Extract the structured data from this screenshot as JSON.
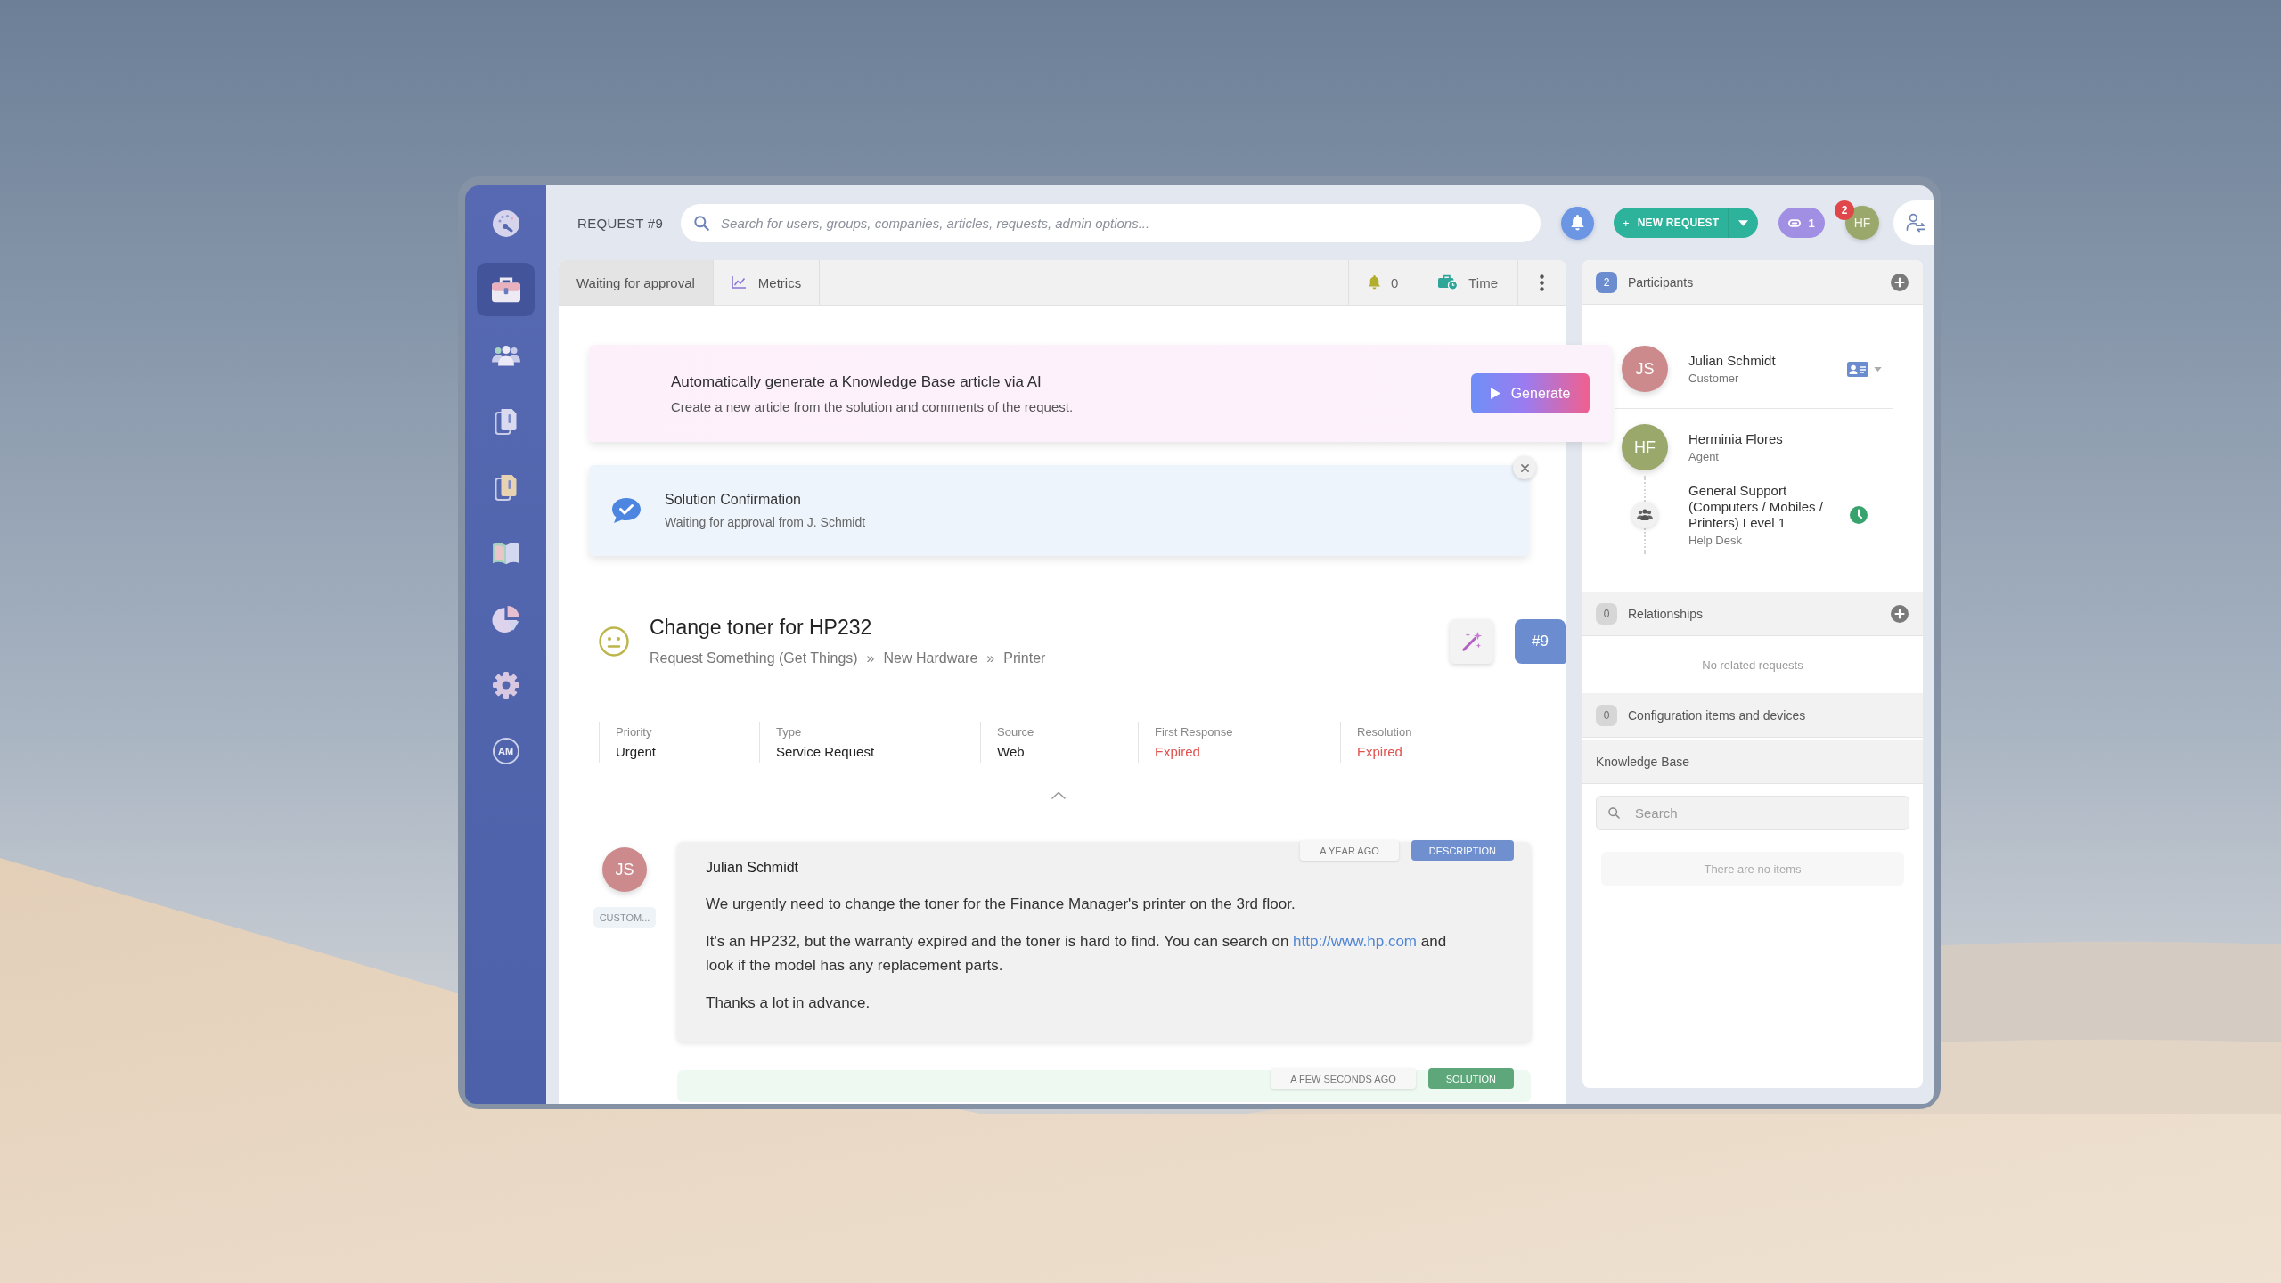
{
  "sidebar": {
    "items": [
      {
        "kind": "gauge",
        "selected": false
      },
      {
        "kind": "briefcase",
        "selected": true
      },
      {
        "kind": "people",
        "selected": false
      },
      {
        "kind": "documents",
        "selected": false
      },
      {
        "kind": "documents-alert",
        "selected": false
      },
      {
        "kind": "book",
        "selected": false
      },
      {
        "kind": "pie",
        "selected": false
      },
      {
        "kind": "gear",
        "selected": false
      },
      {
        "kind": "monogram",
        "label": "AM",
        "selected": false
      }
    ]
  },
  "top_bar": {
    "title": "REQUEST #9",
    "search": {
      "placeholder": "Search for users, groups, companies, articles, requests, admin options..."
    },
    "new_request": {
      "icon": "+",
      "label": "NEW REQUEST"
    },
    "linked_count": "1",
    "user": {
      "initials": "HF",
      "color": "#9aa86c",
      "notifications": "2"
    }
  },
  "tabs": [
    {
      "kind": "status",
      "label": "Waiting for approval",
      "selected": true
    },
    {
      "kind": "metrics",
      "label": "Metrics",
      "selected": false
    }
  ],
  "toolbar": {
    "reminders": "0",
    "time": "Time"
  },
  "ai_banner": {
    "title": "Automatically generate a Knowledge Base article via AI",
    "text": "Create a new article from the solution and comments of the request.",
    "button": "Generate"
  },
  "solution_confirmation": {
    "title": "Solution Confirmation",
    "text": "Waiting for approval from J. Schmidt"
  },
  "request": {
    "title": "Change toner for HP232",
    "breadcrumb": [
      {
        "label": "Request Something (Get Things)"
      },
      {
        "separator": "»",
        "label": "New Hardware"
      },
      {
        "separator": "»",
        "label": "Printer"
      }
    ],
    "number": "#9",
    "fields": [
      {
        "label": "Priority",
        "value": "Urgent",
        "overdue": false
      },
      {
        "label": "Type",
        "value": "Service Request",
        "overdue": false
      },
      {
        "label": "Source",
        "value": "Web",
        "overdue": false
      },
      {
        "label": "First Response",
        "value": "Expired",
        "overdue": true
      },
      {
        "label": "Resolution",
        "value": "Expired",
        "overdue": true
      }
    ]
  },
  "comments": [
    {
      "kind": "description",
      "time": "A YEAR AGO",
      "tag": "DESCRIPTION",
      "author": {
        "initials": "JS",
        "name": "Julian Schmidt",
        "role": "CUSTOM...",
        "color": "#cc8a8c"
      },
      "paragraphs": [
        [
          {
            "kind": "text",
            "text": "We urgently need to change the toner for the Finance Manager's printer on the 3rd floor."
          }
        ],
        [
          {
            "kind": "text",
            "text": "It's an HP232, but the warranty expired and the toner is hard to find. You can search on "
          },
          {
            "kind": "link",
            "text": "http://www.hp.com"
          },
          {
            "kind": "text",
            "text": " and look if the model has any replacement parts."
          }
        ],
        [
          {
            "kind": "text",
            "text": "Thanks a lot in advance."
          }
        ]
      ]
    },
    {
      "kind": "solution",
      "time": "A FEW SECONDS AGO",
      "tag": "SOLUTION"
    }
  ],
  "side_panel": {
    "participants": {
      "title": "Participants",
      "count": "2",
      "count_active": true,
      "people": [
        {
          "kind": "customer",
          "initials": "JS",
          "name": "Julian Schmidt",
          "role": "Customer",
          "color": "#cc8a8c"
        },
        {
          "kind": "agent",
          "initials": "HF",
          "name": "Herminia Flores",
          "role": "Agent",
          "color": "#9aa86c"
        },
        {
          "kind": "group",
          "name": "General Support (Computers / Mobiles / Printers) Level 1",
          "role": "Help Desk"
        }
      ]
    },
    "relationships": {
      "title": "Relationships",
      "count": "0",
      "count_active": false,
      "empty_text": "No related requests"
    },
    "configuration_items": {
      "title": "Configuration items and devices",
      "count": "0",
      "count_active": false
    },
    "knowledge_base": {
      "title": "Knowledge Base",
      "search": {
        "placeholder": "Search"
      },
      "empty_text": "There are no items"
    }
  }
}
